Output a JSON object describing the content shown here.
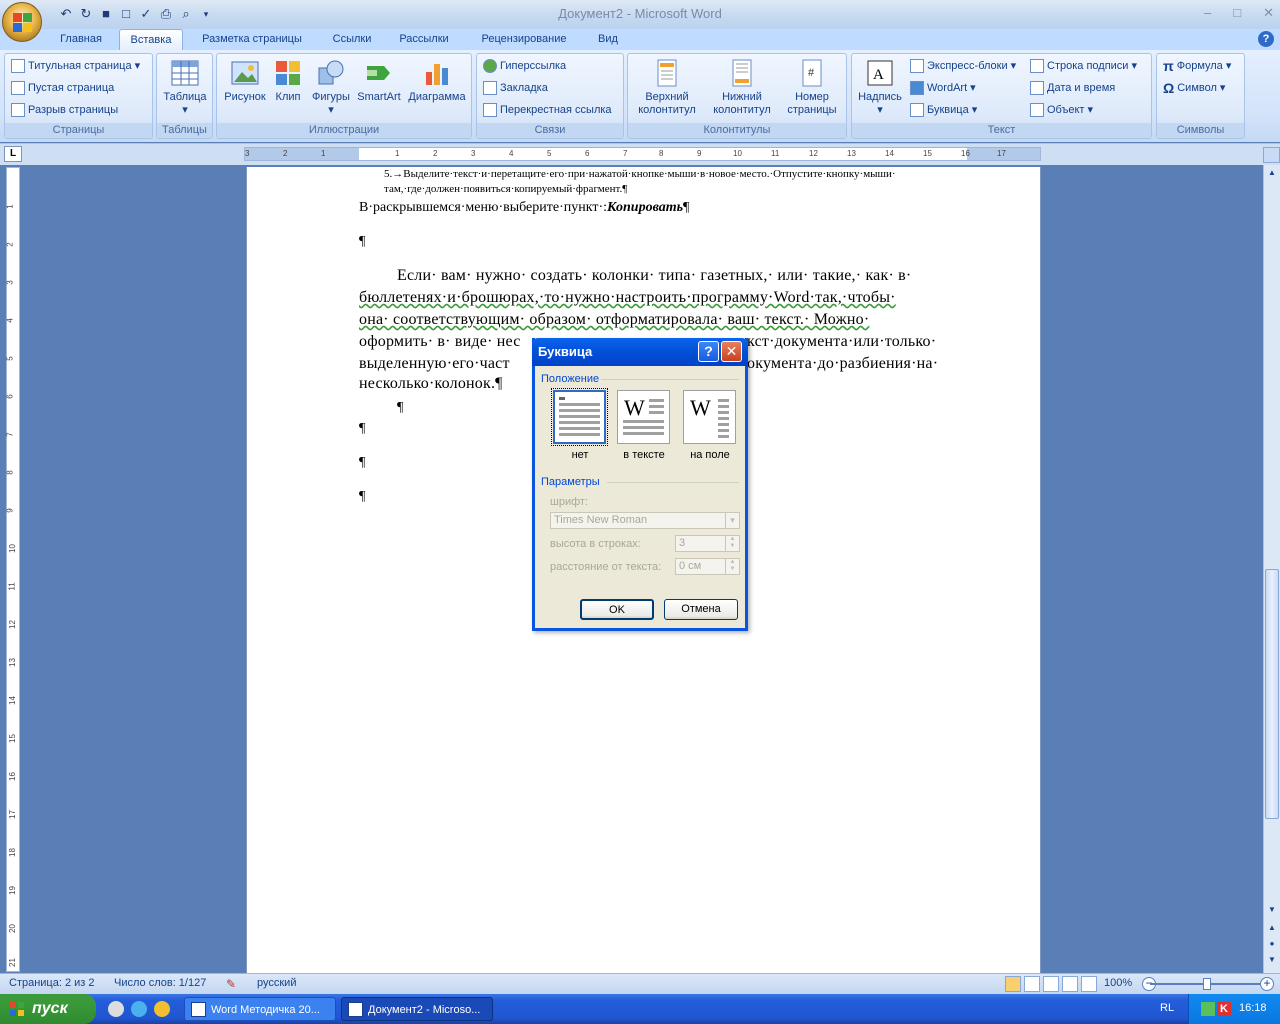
{
  "window": {
    "title": "Документ2 - Microsoft Word",
    "minimize": "–",
    "maximize": "□",
    "close": "✕"
  },
  "ribbon_tabs": [
    "Главная",
    "Вставка",
    "Разметка страницы",
    "Ссылки",
    "Рассылки",
    "Рецензирование",
    "Вид"
  ],
  "ribbon": {
    "pages": {
      "label": "Страницы",
      "cover": "Титульная страница",
      "blank": "Пустая страница",
      "break": "Разрыв страницы"
    },
    "tables": {
      "label": "Таблицы",
      "table": "Таблица"
    },
    "illustrations": {
      "label": "Иллюстрации",
      "picture": "Рисунок",
      "clip": "Клип",
      "shapes": "Фигуры",
      "smartart": "SmartArt",
      "chart": "Диаграмма"
    },
    "links": {
      "label": "Связи",
      "hyperlink": "Гиперссылка",
      "bookmark": "Закладка",
      "crossref": "Перекрестная ссылка"
    },
    "headers": {
      "label": "Колонтитулы",
      "header": "Верхний колонтитул",
      "footer": "Нижний колонтитул",
      "pagenum": "Номер страницы"
    },
    "text": {
      "label": "Текст",
      "textbox": "Надпись",
      "quickparts": "Экспресс-блоки",
      "wordart": "WordArt",
      "dropcap": "Буквица",
      "signature": "Строка подписи",
      "datetime": "Дата и время",
      "object": "Объект"
    },
    "symbols": {
      "label": "Символы",
      "equation": "Формула",
      "symbol": "Символ"
    }
  },
  "ruler": {
    "numbers": [
      "3",
      "2",
      "1",
      "1",
      "2",
      "3",
      "4",
      "5",
      "6",
      "7",
      "8",
      "9",
      "10",
      "11",
      "12",
      "13",
      "14",
      "15",
      "16",
      "17"
    ],
    "vnumbers": [
      "1",
      "2",
      "3",
      "4",
      "5",
      "6",
      "7",
      "8",
      "9",
      "10",
      "11",
      "12",
      "13",
      "14",
      "15",
      "16",
      "17",
      "18",
      "19",
      "20",
      "21"
    ]
  },
  "document": {
    "item5_line1": "5.→Выделите·текст·и·перетащите·его·при·нажатой·кнопке·мыши·в·новое·место.·Отпустите·кнопку·мыши·",
    "item5_line2": "там,·где·должен·появиться·копируемый·фрагмент.¶",
    "menu_line_prefix": "В·раскрывшемся·меню·выберите·пункт·:",
    "menu_line_bold": "Копировать",
    "pilcrow": "¶",
    "para1": "Если· вам· нужно· создать· колонки· типа· газетных,· или· такие,· как· в·",
    "para2": "бюллетенях·и·брошюрах,·то·нужно·настроить·программу·Word·так,·чтобы·",
    "para3": "она· соответствующим· образом· отформатировала· ваш· текст.· Можно·",
    "para4_a": "оформить· в· виде· нес",
    "para4_b": "кст·документа·или·только·",
    "para5_a": "выделенную·его·част",
    "para5_b": "окумента·до·разбиения·на·",
    "para6": "несколько·колонок.¶"
  },
  "dialog": {
    "title": "Буквица",
    "help": "?",
    "close": "✕",
    "position_label": "Положение",
    "pos_none": "нет",
    "pos_intext": "в тексте",
    "pos_margin": "на поле",
    "glyph": "W",
    "params_label": "Параметры",
    "font_label": "шрифт:",
    "font_value": "Times New Roman",
    "lines_label": "высота в строках:",
    "lines_value": "3",
    "dist_label": "расстояние от текста:",
    "dist_value": "0 см",
    "ok": "OK",
    "cancel": "Отмена"
  },
  "statusbar": {
    "page": "Страница: 2 из 2",
    "words": "Число слов: 1/127",
    "language": "русский",
    "zoom": "100%",
    "zoom_out": "−",
    "zoom_in": "+"
  },
  "taskbar": {
    "start": "пуск",
    "task1": "Word Методичка 20...",
    "task2": "Документ2 - Microso...",
    "lang": "RL",
    "clock": "16:18"
  }
}
